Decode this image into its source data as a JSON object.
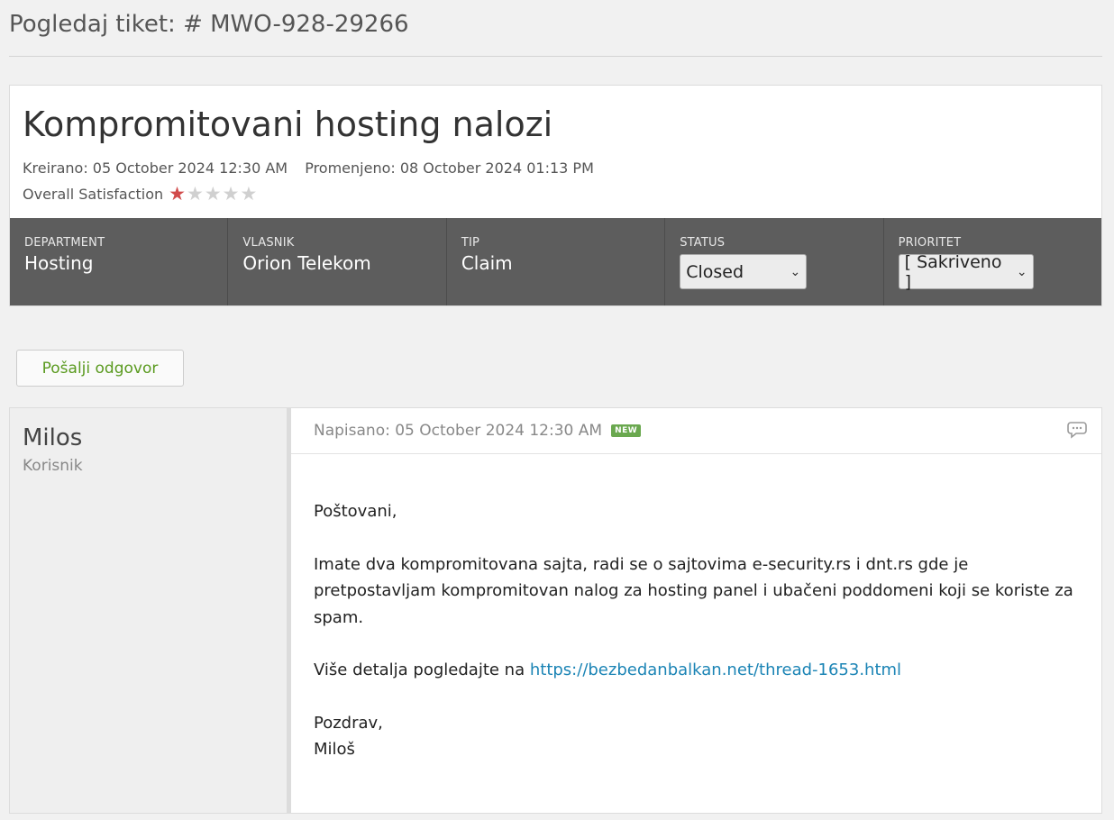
{
  "page": {
    "heading": "Pogledaj tiket: # MWO-928-29266"
  },
  "ticket": {
    "title": "Kompromitovani hosting nalozi",
    "created": "Kreirano: 05 October 2024 12:30 AM",
    "modified": "Promenjeno: 08 October 2024 01:13 PM",
    "satisfaction_label": "Overall Satisfaction",
    "satisfaction_rating": 1,
    "satisfaction_max": 5
  },
  "info": {
    "department": {
      "label": "DEPARTMENT",
      "value": "Hosting"
    },
    "owner": {
      "label": "VLASNIK",
      "value": "Orion Telekom"
    },
    "type": {
      "label": "TIP",
      "value": "Claim"
    },
    "status": {
      "label": "STATUS",
      "value": "Closed"
    },
    "priority": {
      "label": "PRIORITET",
      "value": "[ Sakriveno ]"
    }
  },
  "actions": {
    "reply_label": "Pošalji odgovor"
  },
  "post": {
    "author": "Milos",
    "role": "Korisnik",
    "date": "Napisano: 05 October 2024 12:30 AM",
    "badge": "NEW",
    "greeting": "Poštovani,",
    "paragraph1": "Imate dva kompromitovana sajta, radi se o sajtovima e-security.rs i dnt.rs gde je pretpostavljam kompromitovan nalog za hosting panel i ubačeni poddomeni koji se koriste za spam.",
    "details_prefix": "Više detalja pogledajte na ",
    "details_link": "https://bezbedanbalkan.net/thread-1653.html",
    "closing": "Pozdrav,",
    "signature": "Miloš"
  },
  "colors": {
    "accent_green": "#5a9a1f",
    "info_bar": "#5d5d5d",
    "star_on": "#d14b4b",
    "link": "#1b84b5",
    "badge_green": "#6aa84f"
  }
}
